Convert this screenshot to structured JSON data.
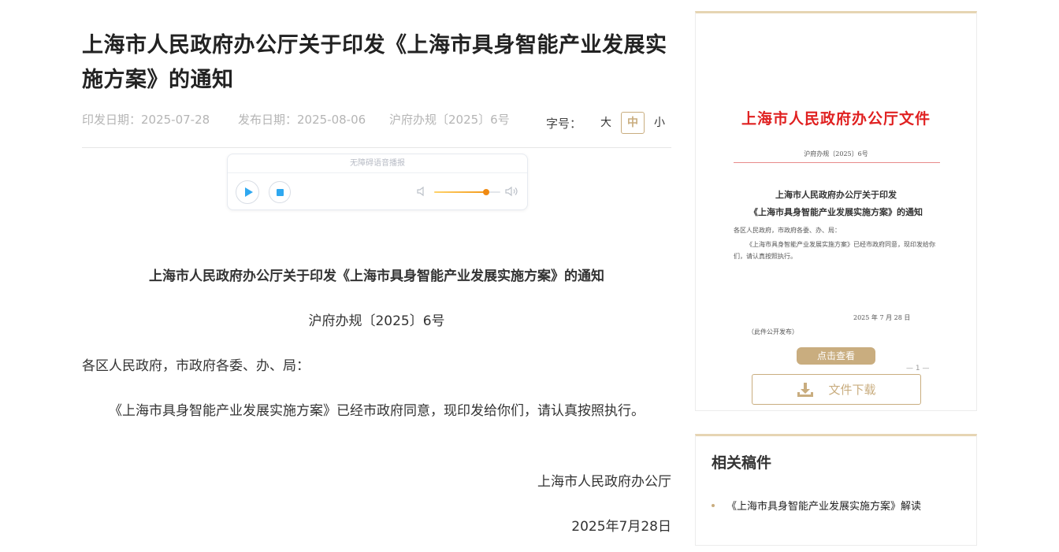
{
  "article": {
    "title": "上海市人民政府办公厅关于印发《上海市具身智能产业发展实施方案》的通知",
    "issue_date": "印发日期：2025-07-28",
    "publish_date": "发布日期：2025-08-06",
    "doc_number": "沪府办规〔2025〕6号",
    "font_size_label": "字号：",
    "font_sizes": [
      "大",
      "中",
      "小"
    ],
    "font_size_selected": "中"
  },
  "audio": {
    "header": "无障碍语音播报",
    "volume_level": 0.78
  },
  "body": {
    "doc_title": "上海市人民政府办公厅关于印发《上海市具身智能产业发展实施方案》的通知",
    "doc_number": "沪府办规〔2025〕6号",
    "salutation": "各区人民政府，市政府各委、办、局：",
    "paragraph": "《上海市具身智能产业发展实施方案》已经市政府同意，现印发给你们，请认真按照执行。",
    "signature": "上海市人民政府办公厅",
    "date": "2025年7月28日"
  },
  "side_doc": {
    "preview": {
      "red_header": "上海市人民政府办公厅文件",
      "doc_number": "沪府办规〔2025〕6号",
      "title_line1": "上海市人民政府办公厅关于印发",
      "title_line2": "《上海市具身智能产业发展实施方案》的通知",
      "salutation": "各区人民政府，市政府各委、办、局：",
      "body": "《上海市具身智能产业发展实施方案》已经市政府同意，现印发给你们，请认真按照执行。",
      "date": "2025 年 7 月 28 日",
      "note": "（此件公开发布）",
      "page": "— 1 —"
    },
    "view_button": "点击查看",
    "download_button": "文件下载"
  },
  "related": {
    "heading": "相关稿件",
    "items": [
      "《上海市具身智能产业发展实施方案》解读"
    ]
  },
  "colors": {
    "accent": "#c9ad7f",
    "red_header": "#e02121",
    "audio_blue": "#2fa8f0",
    "volume_orange": "#f08a12"
  }
}
